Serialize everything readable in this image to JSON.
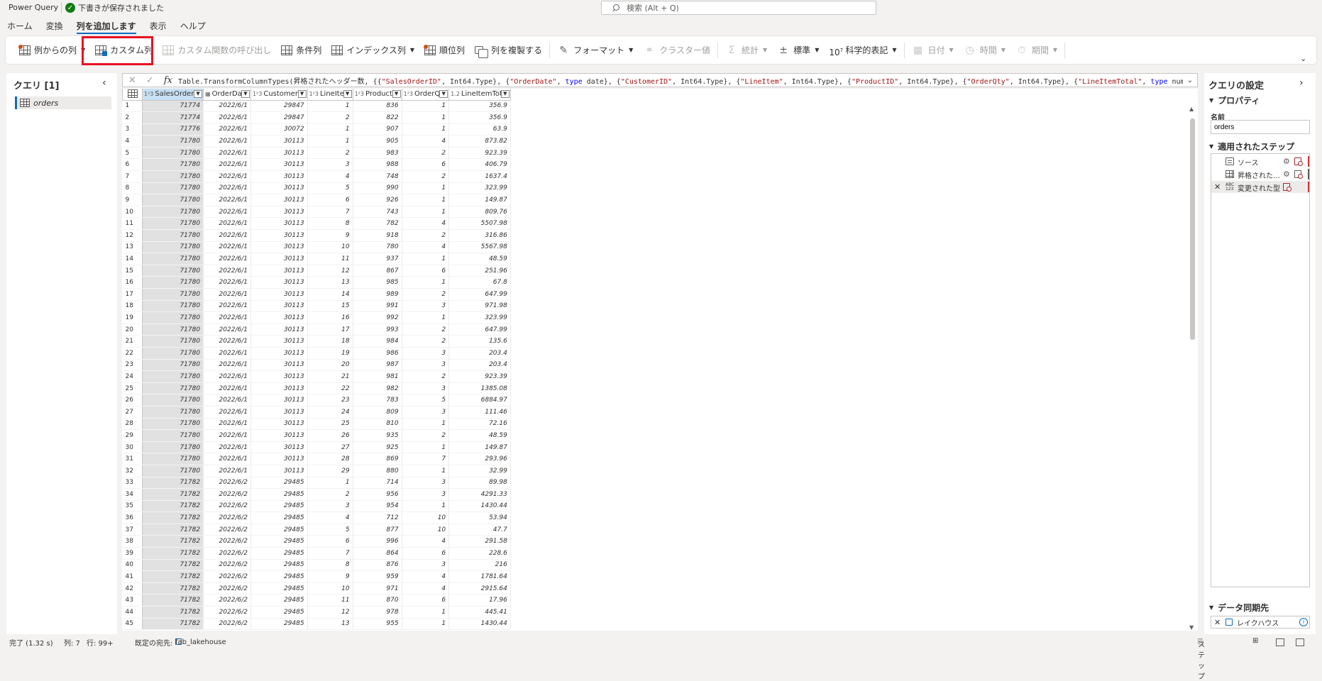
{
  "app": {
    "title": "Power Query",
    "saved_status": "下書きが保存されました"
  },
  "search": {
    "placeholder": "検索 (Alt + Q)"
  },
  "menu": {
    "tabs": [
      "ホーム",
      "変換",
      "列を追加します",
      "表示",
      "ヘルプ"
    ],
    "active": 2
  },
  "ribbon": {
    "column_from_examples": "例からの列",
    "custom_column": "カスタム列",
    "invoke_custom_function": "カスタム関数の呼び出し",
    "conditional_column": "条件列",
    "index_column": "インデックス列",
    "rank_column": "順位列",
    "duplicate_column": "列を複製する",
    "format": "フォーマット",
    "cluster_values": "クラスター値",
    "statistics": "統計",
    "standard": "標準",
    "scientific_exponent": "7",
    "scientific": "科学的表記",
    "date": "日付",
    "time": "時間",
    "duration": "期間"
  },
  "queries": {
    "title": "クエリ [1]",
    "items": [
      "orders"
    ]
  },
  "formula": {
    "fx": "fx",
    "text": "Table.TransformColumnTypes(昇格されたヘッダー数, {{\"SalesOrderID\", Int64.Type}, {\"OrderDate\", type date}, {\"CustomerID\", Int64.Type}, {\"LineItem\", Int64.Type}, {\"ProductID\", Int64.Type}, {\"OrderQty\", Int64.Type}, {\"LineItemTotal\", type number}}, \"ja\")"
  },
  "grid": {
    "columns": [
      {
        "name": "SalesOrderID",
        "type": "1²3",
        "width": 72
      },
      {
        "name": "OrderDate",
        "type": "▦",
        "width": 65
      },
      {
        "name": "CustomerID",
        "type": "1²3",
        "width": 71
      },
      {
        "name": "LineItem",
        "type": "1²3",
        "width": 59
      },
      {
        "name": "ProductID",
        "type": "1²3",
        "width": 66
      },
      {
        "name": "OrderQty",
        "type": "1²3",
        "width": 62
      },
      {
        "name": "LineItemTotal",
        "type": "1.2",
        "width": 79
      }
    ],
    "rows": [
      [
        "71774",
        "2022/6/1",
        "29847",
        "1",
        "836",
        "1",
        "356.9"
      ],
      [
        "71774",
        "2022/6/1",
        "29847",
        "2",
        "822",
        "1",
        "356.9"
      ],
      [
        "71776",
        "2022/6/1",
        "30072",
        "1",
        "907",
        "1",
        "63.9"
      ],
      [
        "71780",
        "2022/6/1",
        "30113",
        "1",
        "905",
        "4",
        "873.82"
      ],
      [
        "71780",
        "2022/6/1",
        "30113",
        "2",
        "983",
        "2",
        "923.39"
      ],
      [
        "71780",
        "2022/6/1",
        "30113",
        "3",
        "988",
        "6",
        "406.79"
      ],
      [
        "71780",
        "2022/6/1",
        "30113",
        "4",
        "748",
        "2",
        "1637.4"
      ],
      [
        "71780",
        "2022/6/1",
        "30113",
        "5",
        "990",
        "1",
        "323.99"
      ],
      [
        "71780",
        "2022/6/1",
        "30113",
        "6",
        "926",
        "1",
        "149.87"
      ],
      [
        "71780",
        "2022/6/1",
        "30113",
        "7",
        "743",
        "1",
        "809.76"
      ],
      [
        "71780",
        "2022/6/1",
        "30113",
        "8",
        "782",
        "4",
        "5507.98"
      ],
      [
        "71780",
        "2022/6/1",
        "30113",
        "9",
        "918",
        "2",
        "316.86"
      ],
      [
        "71780",
        "2022/6/1",
        "30113",
        "10",
        "780",
        "4",
        "5567.98"
      ],
      [
        "71780",
        "2022/6/1",
        "30113",
        "11",
        "937",
        "1",
        "48.59"
      ],
      [
        "71780",
        "2022/6/1",
        "30113",
        "12",
        "867",
        "6",
        "251.96"
      ],
      [
        "71780",
        "2022/6/1",
        "30113",
        "13",
        "985",
        "1",
        "67.8"
      ],
      [
        "71780",
        "2022/6/1",
        "30113",
        "14",
        "989",
        "2",
        "647.99"
      ],
      [
        "71780",
        "2022/6/1",
        "30113",
        "15",
        "991",
        "3",
        "971.98"
      ],
      [
        "71780",
        "2022/6/1",
        "30113",
        "16",
        "992",
        "1",
        "323.99"
      ],
      [
        "71780",
        "2022/6/1",
        "30113",
        "17",
        "993",
        "2",
        "647.99"
      ],
      [
        "71780",
        "2022/6/1",
        "30113",
        "18",
        "984",
        "2",
        "135.6"
      ],
      [
        "71780",
        "2022/6/1",
        "30113",
        "19",
        "986",
        "3",
        "203.4"
      ],
      [
        "71780",
        "2022/6/1",
        "30113",
        "20",
        "987",
        "3",
        "203.4"
      ],
      [
        "71780",
        "2022/6/1",
        "30113",
        "21",
        "981",
        "2",
        "923.39"
      ],
      [
        "71780",
        "2022/6/1",
        "30113",
        "22",
        "982",
        "3",
        "1385.08"
      ],
      [
        "71780",
        "2022/6/1",
        "30113",
        "23",
        "783",
        "5",
        "6884.97"
      ],
      [
        "71780",
        "2022/6/1",
        "30113",
        "24",
        "809",
        "3",
        "111.46"
      ],
      [
        "71780",
        "2022/6/1",
        "30113",
        "25",
        "810",
        "1",
        "72.16"
      ],
      [
        "71780",
        "2022/6/1",
        "30113",
        "26",
        "935",
        "2",
        "48.59"
      ],
      [
        "71780",
        "2022/6/1",
        "30113",
        "27",
        "925",
        "1",
        "149.87"
      ],
      [
        "71780",
        "2022/6/1",
        "30113",
        "28",
        "869",
        "7",
        "293.96"
      ],
      [
        "71780",
        "2022/6/1",
        "30113",
        "29",
        "880",
        "1",
        "32.99"
      ],
      [
        "71782",
        "2022/6/2",
        "29485",
        "1",
        "714",
        "3",
        "89.98"
      ],
      [
        "71782",
        "2022/6/2",
        "29485",
        "2",
        "956",
        "3",
        "4291.33"
      ],
      [
        "71782",
        "2022/6/2",
        "29485",
        "3",
        "954",
        "1",
        "1430.44"
      ],
      [
        "71782",
        "2022/6/2",
        "29485",
        "4",
        "712",
        "10",
        "53.94"
      ],
      [
        "71782",
        "2022/6/2",
        "29485",
        "5",
        "877",
        "10",
        "47.7"
      ],
      [
        "71782",
        "2022/6/2",
        "29485",
        "6",
        "996",
        "4",
        "291.58"
      ],
      [
        "71782",
        "2022/6/2",
        "29485",
        "7",
        "864",
        "6",
        "228.6"
      ],
      [
        "71782",
        "2022/6/2",
        "29485",
        "8",
        "876",
        "3",
        "216"
      ],
      [
        "71782",
        "2022/6/2",
        "29485",
        "9",
        "959",
        "4",
        "1781.64"
      ],
      [
        "71782",
        "2022/6/2",
        "29485",
        "10",
        "971",
        "4",
        "2915.64"
      ],
      [
        "71782",
        "2022/6/2",
        "29485",
        "11",
        "870",
        "6",
        "17.96"
      ],
      [
        "71782",
        "2022/6/2",
        "29485",
        "12",
        "978",
        "1",
        "445.41"
      ],
      [
        "71782",
        "2022/6/2",
        "29485",
        "13",
        "955",
        "1",
        "1430.44"
      ]
    ]
  },
  "settings": {
    "title": "クエリの設定",
    "properties": "プロパティ",
    "name_label": "名前",
    "name_value": "orders",
    "applied_steps": "適用されたステップ",
    "steps": [
      "ソース",
      "昇格されたヘッダー数",
      "変更された型"
    ],
    "data_destination": "データ同期先",
    "destination": "レイクハウス"
  },
  "status": {
    "done": "完了 (1.32 s)",
    "columns": "列: 7",
    "rows": "行: 99+",
    "default_destination_label": "既定の宛先:",
    "default_destination": "fab_lakehouse",
    "step": "ステップ"
  }
}
